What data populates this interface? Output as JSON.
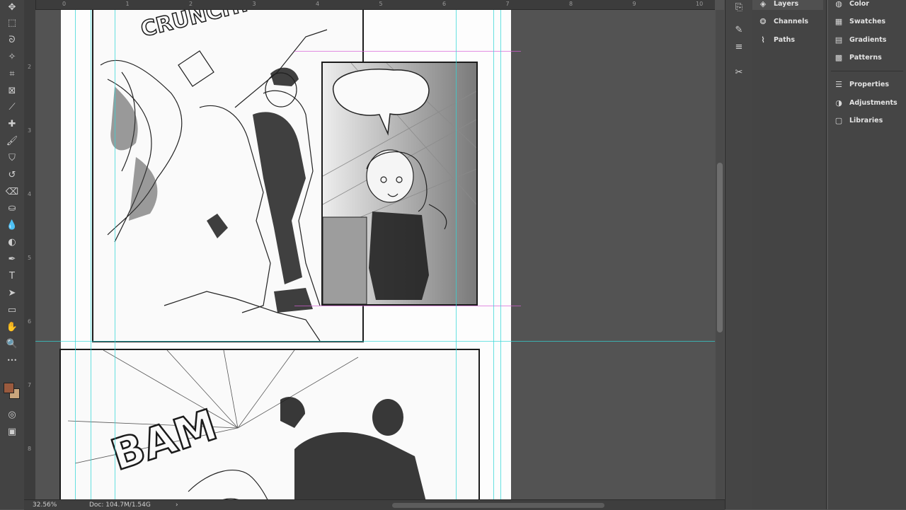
{
  "toolbar": {
    "tools": [
      {
        "name": "move-tool-icon",
        "glyph": "✥"
      },
      {
        "name": "marquee-tool-icon",
        "glyph": "⬚"
      },
      {
        "name": "lasso-tool-icon",
        "glyph": "ᘐ"
      },
      {
        "name": "magic-wand-tool-icon",
        "glyph": "✧"
      },
      {
        "name": "crop-tool-icon",
        "glyph": "⌗"
      },
      {
        "name": "frame-tool-icon",
        "glyph": "⊠"
      },
      {
        "name": "eyedropper-tool-icon",
        "glyph": "⟋"
      },
      {
        "name": "healing-brush-tool-icon",
        "glyph": "✚"
      },
      {
        "name": "brush-tool-icon",
        "glyph": "🖌"
      },
      {
        "name": "clone-stamp-tool-icon",
        "glyph": "⛉"
      },
      {
        "name": "history-brush-tool-icon",
        "glyph": "↺"
      },
      {
        "name": "eraser-tool-icon",
        "glyph": "⌫"
      },
      {
        "name": "paint-bucket-tool-icon",
        "glyph": "⛀"
      },
      {
        "name": "blur-tool-icon",
        "glyph": "💧"
      },
      {
        "name": "dodge-tool-icon",
        "glyph": "◐"
      },
      {
        "name": "pen-tool-icon",
        "glyph": "✒"
      },
      {
        "name": "type-tool-icon",
        "glyph": "T"
      },
      {
        "name": "path-selection-tool-icon",
        "glyph": "➤"
      },
      {
        "name": "rectangle-tool-icon",
        "glyph": "▭"
      },
      {
        "name": "hand-tool-icon",
        "glyph": "✋"
      },
      {
        "name": "zoom-tool-icon",
        "glyph": "🔍"
      },
      {
        "name": "more-tools-icon",
        "glyph": "•••"
      }
    ],
    "foreground_color": "#9a5a3e",
    "background_color": "#c9a57c"
  },
  "ruler": {
    "top_ticks": [
      "0",
      "1",
      "2",
      "3",
      "4",
      "5",
      "6",
      "7",
      "8",
      "9",
      "10"
    ],
    "left_ticks": [
      "2",
      "3",
      "4",
      "5",
      "6",
      "7",
      "8"
    ]
  },
  "status": {
    "zoom": "32.56%",
    "doc": "Doc: 104.7M/1.54G"
  },
  "panels_a": [
    {
      "icon": "layers-icon",
      "glyph": "◈",
      "label": "Layers"
    },
    {
      "icon": "channels-icon",
      "glyph": "❂",
      "label": "Channels"
    },
    {
      "icon": "paths-icon",
      "glyph": "⌇",
      "label": "Paths"
    }
  ],
  "panels_b": [
    {
      "icon": "color-icon",
      "glyph": "◍",
      "label": "Color"
    },
    {
      "icon": "swatches-icon",
      "glyph": "▦",
      "label": "Swatches"
    },
    {
      "icon": "gradients-icon",
      "glyph": "▤",
      "label": "Gradients"
    },
    {
      "icon": "patterns-icon",
      "glyph": "▩",
      "label": "Patterns"
    },
    {
      "icon": "properties-icon",
      "glyph": "☰",
      "label": "Properties"
    },
    {
      "icon": "adjustments-icon",
      "glyph": "◑",
      "label": "Adjustments"
    },
    {
      "icon": "libraries-icon",
      "glyph": "▢",
      "label": "Libraries"
    }
  ],
  "comic": {
    "sfx_top": "CRUNCH!",
    "sfx_bottom": "BAM"
  }
}
